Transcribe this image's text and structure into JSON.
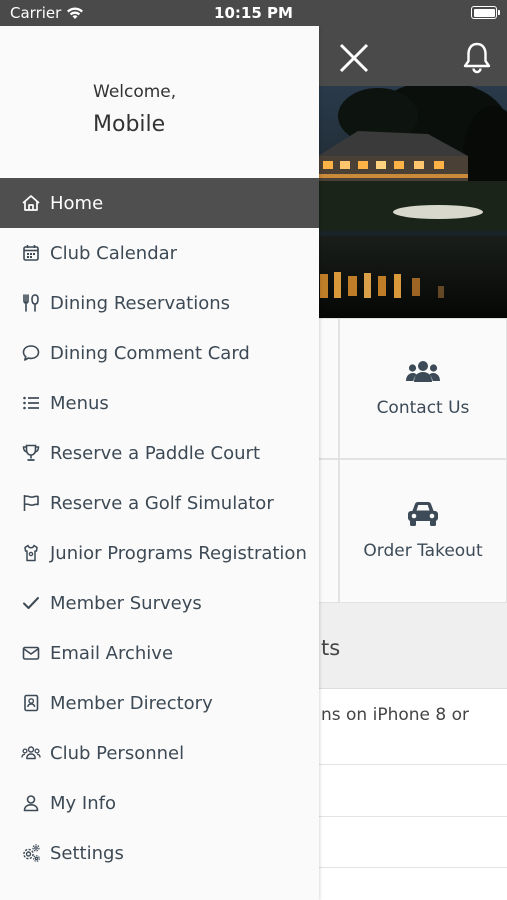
{
  "status_bar": {
    "carrier": "Carrier",
    "time": "10:15 PM"
  },
  "drawer": {
    "welcome": "Welcome,",
    "user_name": "Mobile",
    "items": [
      {
        "label": "Home",
        "icon": "home-icon",
        "active": true
      },
      {
        "label": "Club Calendar",
        "icon": "calendar-icon"
      },
      {
        "label": "Dining Reservations",
        "icon": "utensils-icon"
      },
      {
        "label": "Dining Comment Card",
        "icon": "comment-icon"
      },
      {
        "label": "Menus",
        "icon": "list-icon"
      },
      {
        "label": "Reserve a Paddle Court",
        "icon": "trophy-icon"
      },
      {
        "label": "Reserve a Golf Simulator",
        "icon": "flag-icon"
      },
      {
        "label": "Junior Programs Registration",
        "icon": "shirt-icon"
      },
      {
        "label": "Member Surveys",
        "icon": "check-icon"
      },
      {
        "label": "Email Archive",
        "icon": "envelope-icon"
      },
      {
        "label": "Member Directory",
        "icon": "address-book-icon"
      },
      {
        "label": "Club Personnel",
        "icon": "users-icon"
      },
      {
        "label": "My Info",
        "icon": "user-icon"
      },
      {
        "label": "Settings",
        "icon": "gears-icon"
      }
    ]
  },
  "tiles": {
    "contact_us": "Contact Us",
    "order_takeout": "Order Takeout"
  },
  "section_heading_partial": "ts",
  "news_row_partial": "ns on iPhone 8 or",
  "colors": {
    "header_bg": "#4a4a4a",
    "active_item_bg": "#4f4f4f",
    "tile_text": "#3c4b57"
  }
}
